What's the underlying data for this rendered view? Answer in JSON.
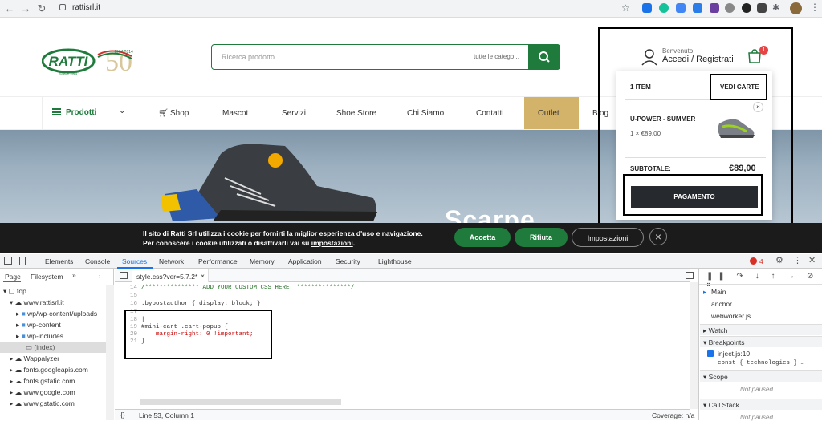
{
  "browser": {
    "url": "rattisrl.it"
  },
  "header": {
    "logo_text": "RATTI",
    "logo_years": "1964 2014",
    "logo_since": "SINCE 1964",
    "logo_anniversary": "50",
    "search_placeholder": "Ricerca prodotto...",
    "search_category": "tutte le catego...",
    "welcome": "Benvenuto",
    "login": "Accedi / Registrati",
    "cart_count": "1"
  },
  "nav": {
    "products": "Prodotti",
    "items": [
      "Shop",
      "Mascot",
      "Servizi",
      "Shoe Store",
      "Chi Siamo",
      "Contatti",
      "Outlet",
      "Blog"
    ]
  },
  "hero": {
    "text": "Scarpe"
  },
  "minicart": {
    "item_count": "1 ITEM",
    "view_cart": "VEDI CARTE",
    "product_name": "U-POWER - SUMMER",
    "product_qty": "1 × €89,00",
    "remove": "×",
    "subtotal_label": "SUBTOTALE:",
    "subtotal_value": "€89,00",
    "checkout": "PAGAMENTO"
  },
  "cookie": {
    "line1": "Il sito di Ratti Srl utilizza i cookie per fornirti la miglior esperienza d'uso e navigazione.",
    "line2a": "Per conoscere i cookie utilizzati o disattivarli vai su ",
    "line2link": "impostazioni",
    "line2b": ".",
    "accept": "Accetta",
    "reject": "Rifiuta",
    "settings": "Impostazioni",
    "close": "×"
  },
  "devtools": {
    "tabs": [
      "Elements",
      "Console",
      "Sources",
      "Network",
      "Performance",
      "Memory",
      "Application",
      "Security",
      "Lighthouse"
    ],
    "error_count": "4",
    "left_tabs": [
      "Page",
      "Filesystem",
      "»"
    ],
    "tree": [
      "top",
      "www.rattisrl.it",
      "wp/wp-content/uploads",
      "wp-content",
      "wp-includes",
      "(index)",
      "Wappalyzer",
      "fonts.googleapis.com",
      "fonts.gstatic.com",
      "www.google.com",
      "www.gstatic.com"
    ],
    "file_tab": "style.css?ver=5.7.2*",
    "code_lines": [
      {
        "n": "14",
        "t": "/*************** ADD YOUR CUSTOM CSS HERE  ***************/"
      },
      {
        "n": "15",
        "t": ""
      },
      {
        "n": "16",
        "t": ".bypostauthor { display: block; }"
      },
      {
        "n": "17",
        "t": ""
      },
      {
        "n": "18",
        "t": "|"
      },
      {
        "n": "19",
        "t": "#mini-cart .cart-popup {"
      },
      {
        "n": "20",
        "t": "    margin-right: 0 !important;"
      },
      {
        "n": "21",
        "t": "}"
      }
    ],
    "status_left": "{}",
    "status_pos": "Line 53, Column 1",
    "status_coverage": "Coverage: n/a",
    "threads": [
      "Main",
      "anchor",
      "webworker.js"
    ],
    "watch": "Watch",
    "breakpoints": "Breakpoints",
    "bp_file": "inject.js:10",
    "bp_code": "const { technologies } …",
    "scope": "Scope",
    "not_paused": "Not paused",
    "callstack": "Call Stack",
    "not_paused2": "Not paused"
  }
}
